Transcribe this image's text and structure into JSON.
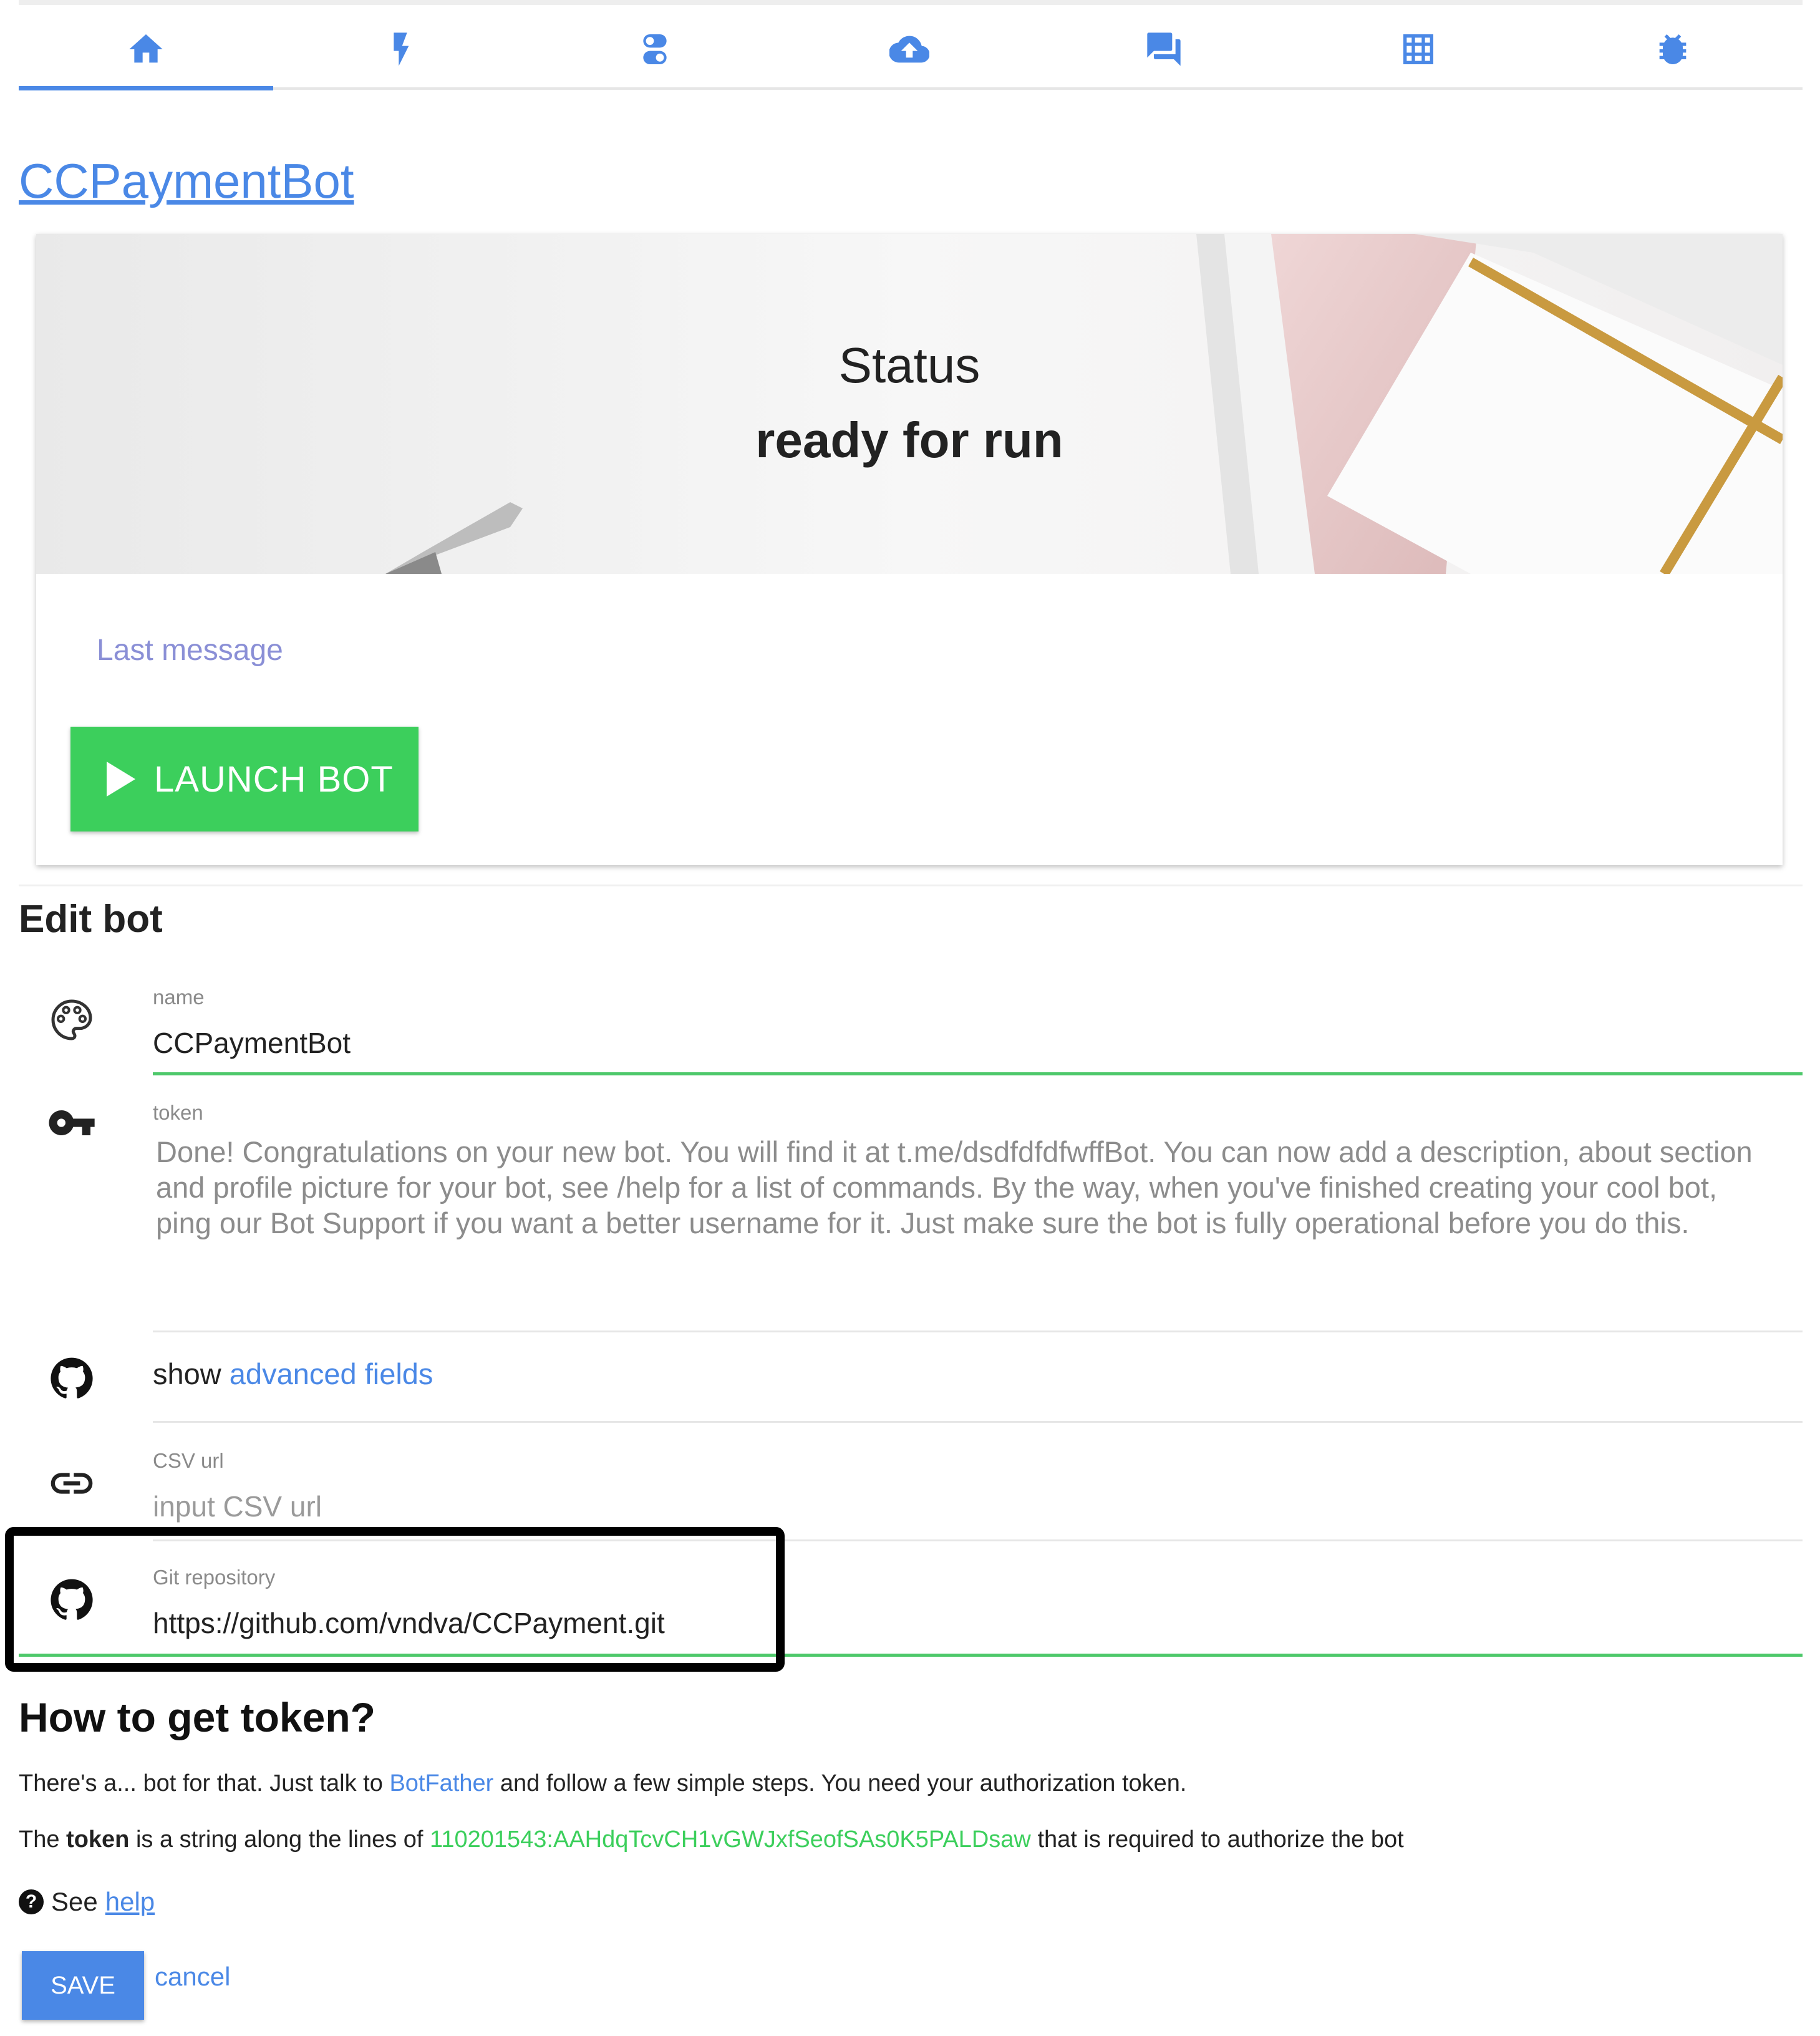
{
  "tabs": [
    {
      "icon": "home-icon"
    },
    {
      "icon": "lightning-icon"
    },
    {
      "icon": "toggle-icon"
    },
    {
      "icon": "cloud-upload-icon"
    },
    {
      "icon": "chat-icon"
    },
    {
      "icon": "grid-icon"
    },
    {
      "icon": "bug-icon"
    }
  ],
  "colors": {
    "accent": "#4a88e6",
    "success": "#3ccf5c",
    "field_underline": "#4dc86a"
  },
  "bot_title": "CCPaymentBot",
  "status": {
    "label": "Status",
    "value": "ready for run",
    "last_message_label": "Last message",
    "launch_label": "LAUNCH BOT"
  },
  "edit": {
    "heading": "Edit bot",
    "name_label": "name",
    "name_value": "CCPaymentBot",
    "token_label": "token",
    "token_value": "Done! Congratulations on your new bot. You will find it at t.me/dsdfdfdfwffBot. You can now add a description, about section and profile picture for your bot, see /help for a list of commands. By the way, when you've finished creating your cool bot, ping our Bot Support if you want a better username for it. Just make sure the bot is fully operational before you do this.",
    "show_prefix": "show",
    "show_link": "advanced fields",
    "csv_label": "CSV url",
    "csv_placeholder": "input CSV url",
    "git_label": "Git repository",
    "git_value": "https://github.com/vndva/CCPayment.git"
  },
  "howto": {
    "heading": "How to get token?",
    "p1_a": "There's a... bot for that. Just talk to",
    "p1_link": "BotFather",
    "p1_b": "and follow a few simple steps. You need your authorization token.",
    "p2_a": "The",
    "p2_bold": "token",
    "p2_b": "is a string along the lines of",
    "p2_token": "110201543:AAHdqTcvCH1vGWJxfSeofSAs0K5PALDsaw",
    "p2_c": "that is required to authorize the bot",
    "see_label": "See",
    "help_link": "help"
  },
  "actions": {
    "save_label": "SAVE",
    "cancel_label": "cancel"
  }
}
